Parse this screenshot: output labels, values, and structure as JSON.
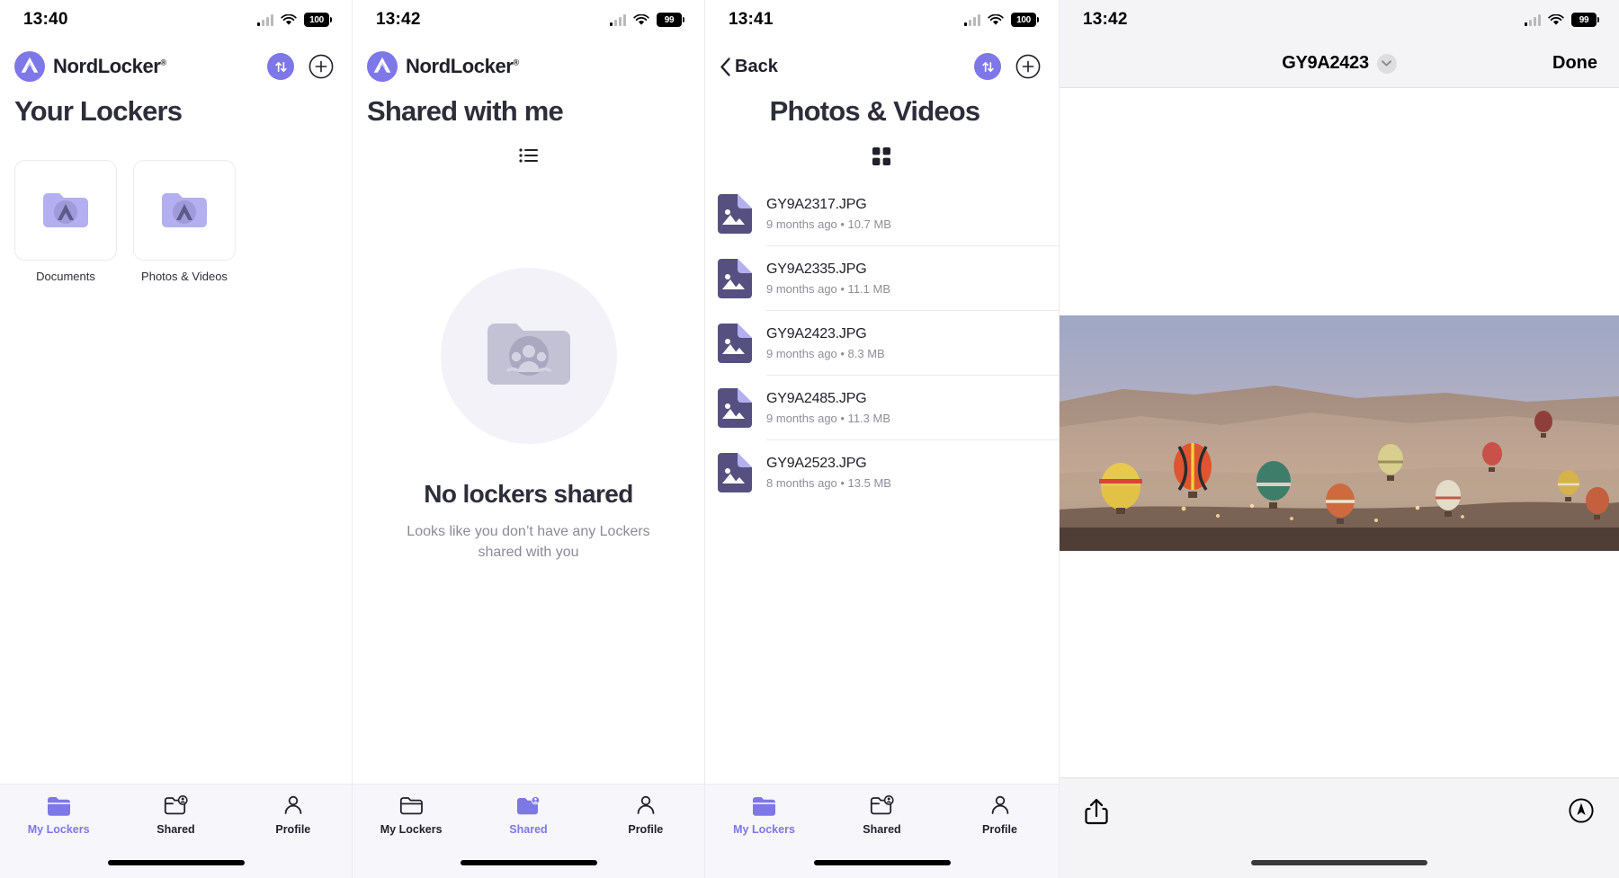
{
  "brand": {
    "name": "NordLocker",
    "registered_mark": "®"
  },
  "colors": {
    "accent_purple": "#7d77e8",
    "folder_purple": "#b3aff0",
    "file_icon_purple": "#565080",
    "text_dark": "#2d2e3a",
    "text_muted": "#8e8e99",
    "tabbar_bg": "#f7f6fb"
  },
  "panels": [
    {
      "id": "your-lockers",
      "status": {
        "time": "13:40",
        "battery": "100",
        "signal_icon": "cellular-bars-icon",
        "wifi_icon": "wifi-icon"
      },
      "header": {
        "sort_icon": "sort-arrows-icon",
        "add_icon": "plus-circle-icon"
      },
      "title": "Your Lockers",
      "lockers": [
        {
          "label": "Documents",
          "icon": "locker-folder-icon"
        },
        {
          "label": "Photos & Videos",
          "icon": "locker-folder-icon"
        }
      ],
      "tabs": [
        {
          "label": "My Lockers",
          "icon": "folder-icon",
          "active": true
        },
        {
          "label": "Shared",
          "icon": "folder-shared-icon",
          "active": false
        },
        {
          "label": "Profile",
          "icon": "person-icon",
          "active": false
        }
      ]
    },
    {
      "id": "shared-with-me",
      "status": {
        "time": "13:42",
        "battery": "99",
        "signal_icon": "cellular-bars-icon",
        "wifi_icon": "wifi-icon"
      },
      "header": {
        "sort_icon": "sort-arrows-icon",
        "add_icon": "plus-circle-icon"
      },
      "title": "Shared with me",
      "view_toggle_icon": "list-view-icon",
      "empty_state": {
        "icon": "shared-folder-people-icon",
        "title": "No lockers shared",
        "subtitle": "Looks like you don’t have any Lockers shared with you"
      },
      "tabs": [
        {
          "label": "My Lockers",
          "icon": "folder-icon",
          "active": false
        },
        {
          "label": "Shared",
          "icon": "folder-shared-icon",
          "active": true
        },
        {
          "label": "Profile",
          "icon": "person-icon",
          "active": false
        }
      ]
    },
    {
      "id": "photos-and-videos",
      "status": {
        "time": "13:41",
        "battery": "100",
        "signal_icon": "cellular-bars-icon",
        "wifi_icon": "wifi-icon"
      },
      "header": {
        "back_label": "Back",
        "back_icon": "chevron-left-icon",
        "sort_icon": "sort-arrows-icon",
        "add_icon": "plus-circle-icon"
      },
      "title": "Photos & Videos",
      "view_toggle_icon": "grid-view-icon",
      "files": [
        {
          "name": "GY9A2317.JPG",
          "meta": "9 months ago • 10.7 MB",
          "icon": "image-file-icon"
        },
        {
          "name": "GY9A2335.JPG",
          "meta": "9 months ago • 11.1 MB",
          "icon": "image-file-icon"
        },
        {
          "name": "GY9A2423.JPG",
          "meta": "9 months ago • 8.3 MB",
          "icon": "image-file-icon"
        },
        {
          "name": "GY9A2485.JPG",
          "meta": "9 months ago • 11.3 MB",
          "icon": "image-file-icon"
        },
        {
          "name": "GY9A2523.JPG",
          "meta": "8 months ago • 13.5 MB",
          "icon": "image-file-icon"
        }
      ],
      "tabs": [
        {
          "label": "My Lockers",
          "icon": "folder-icon",
          "active": true
        },
        {
          "label": "Shared",
          "icon": "folder-shared-icon",
          "active": false
        },
        {
          "label": "Profile",
          "icon": "person-icon",
          "active": false
        }
      ]
    },
    {
      "id": "photo-preview",
      "status": {
        "time": "13:42",
        "battery": "99",
        "signal_icon": "cellular-bars-icon",
        "wifi_icon": "wifi-icon"
      },
      "title": "GY9A2423",
      "title_chevron_icon": "chevron-down-icon",
      "done_label": "Done",
      "photo_alt": "hot air balloons over desert valley at dawn",
      "toolbar": {
        "share_icon": "share-icon",
        "markup_icon": "markup-circle-icon"
      }
    }
  ]
}
